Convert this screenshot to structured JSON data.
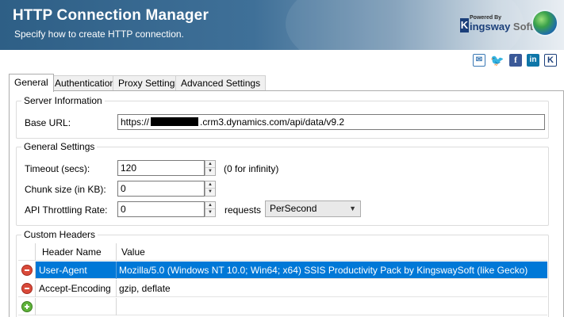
{
  "banner": {
    "title": "HTTP Connection Manager",
    "subtitle": "Specify how to create HTTP connection.",
    "logo_powered": "Powered By",
    "logo_name_a": "ingsway",
    "logo_name_b": "Soft",
    "logo_letter": "K"
  },
  "social": {
    "mail": "✉",
    "twitter": "🐦",
    "facebook": "f",
    "linkedin": "in",
    "kingsway": "K"
  },
  "tabs": [
    {
      "label": "General"
    },
    {
      "label": "Authentication"
    },
    {
      "label": "Proxy Settings"
    },
    {
      "label": "Advanced Settings"
    }
  ],
  "server_info": {
    "group_label": "Server Information",
    "base_url_label": "Base URL:",
    "base_url_prefix": "https://",
    "base_url_suffix": ".crm3.dynamics.com/api/data/v9.2"
  },
  "general_settings": {
    "group_label": "General Settings",
    "timeout_label": "Timeout (secs):",
    "timeout_value": "120",
    "timeout_hint": "(0 for infinity)",
    "chunk_label": "Chunk size (in KB):",
    "chunk_value": "0",
    "throttle_label": "API Throttling Rate:",
    "throttle_value": "0",
    "throttle_unit": "requests",
    "throttle_period": "PerSecond"
  },
  "custom_headers": {
    "group_label": "Custom Headers",
    "columns": [
      "Header Name",
      "Value"
    ],
    "rows": [
      {
        "name": "User-Agent",
        "value": "Mozilla/5.0 (Windows NT 10.0; Win64; x64) SSIS Productivity Pack by KingswaySoft (like Gecko)",
        "selected": true
      },
      {
        "name": "Accept-Encoding",
        "value": "gzip, deflate",
        "selected": false
      }
    ]
  },
  "colors": {
    "selection": "#0078d7",
    "banner": "#2e5f86",
    "remove_icon": "#d94a3a",
    "add_icon": "#5fb33a"
  }
}
